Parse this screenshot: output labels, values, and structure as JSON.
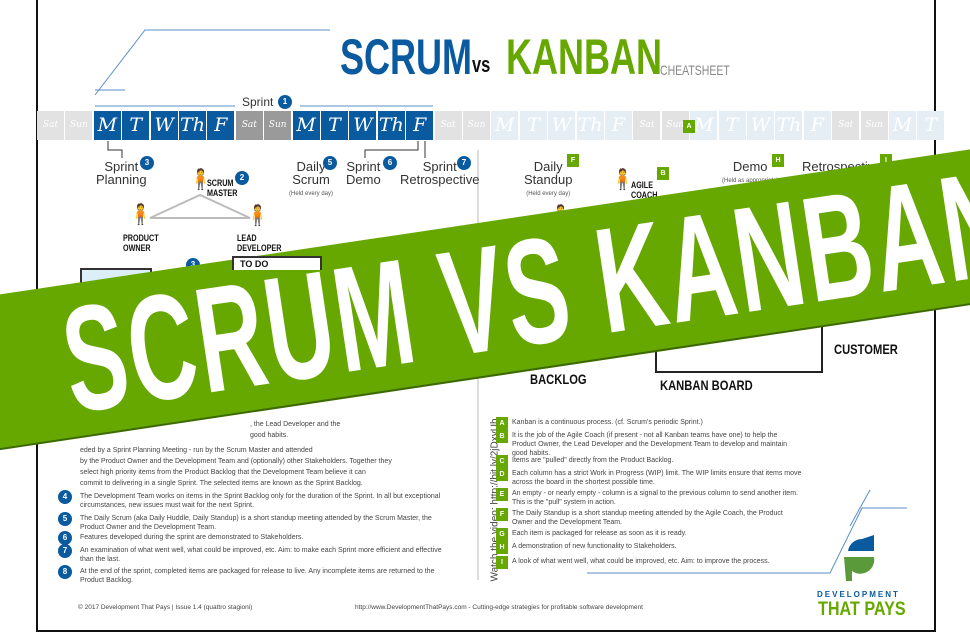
{
  "title": {
    "scrum": "SCRUM",
    "vs": "vs",
    "kanban": "KANBAN",
    "subtitle": "CHEATSHEET"
  },
  "colors": {
    "scrum_blue": "#0a5aa0",
    "kanban_green": "#66a800"
  },
  "sprint": {
    "label": "Sprint",
    "badge": "1"
  },
  "days": [
    {
      "d": "Sat",
      "s": "wklight"
    },
    {
      "d": "Sun",
      "s": "wklight"
    },
    {
      "d": "M",
      "s": "active"
    },
    {
      "d": "T",
      "s": "active"
    },
    {
      "d": "W",
      "s": "active"
    },
    {
      "d": "Th",
      "s": "active"
    },
    {
      "d": "F",
      "s": "active"
    },
    {
      "d": "Sat",
      "s": "wkdark"
    },
    {
      "d": "Sun",
      "s": "wkdark"
    },
    {
      "d": "M",
      "s": "active"
    },
    {
      "d": "T",
      "s": "active"
    },
    {
      "d": "W",
      "s": "active"
    },
    {
      "d": "Th",
      "s": "active"
    },
    {
      "d": "F",
      "s": "active"
    },
    {
      "d": "Sat",
      "s": "wklight"
    },
    {
      "d": "Sun",
      "s": "wklight"
    },
    {
      "d": "M",
      "s": "faded"
    },
    {
      "d": "T",
      "s": "faded"
    },
    {
      "d": "W",
      "s": "faded"
    },
    {
      "d": "Th",
      "s": "faded"
    },
    {
      "d": "F",
      "s": "faded"
    },
    {
      "d": "Sat",
      "s": "wklight"
    },
    {
      "d": "Sun",
      "s": "wklight"
    },
    {
      "d": "M",
      "s": "faded"
    },
    {
      "d": "T",
      "s": "faded"
    },
    {
      "d": "W",
      "s": "faded"
    },
    {
      "d": "Th",
      "s": "faded"
    },
    {
      "d": "F",
      "s": "faded"
    },
    {
      "d": "Sat",
      "s": "wklight"
    },
    {
      "d": "Sun",
      "s": "wklight"
    },
    {
      "d": "M",
      "s": "faded"
    },
    {
      "d": "T",
      "s": "faded"
    }
  ],
  "scrum": {
    "events": {
      "planning": {
        "l1": "Sprint",
        "l2": "Planning",
        "badge": "3"
      },
      "daily": {
        "l1": "Daily",
        "l2": "Scrum",
        "note": "(Held every day)",
        "badge": "5"
      },
      "demo": {
        "l1": "Sprint",
        "l2": "Demo",
        "badge": "6"
      },
      "retro": {
        "l1": "Sprint",
        "l2": "Retrospective",
        "badge": "7"
      }
    },
    "roles": {
      "master": {
        "l1": "SCRUM",
        "l2": "MASTER",
        "badge": "2"
      },
      "owner": {
        "l1": "PRODUCT",
        "l2": "OWNER"
      },
      "lead": {
        "l1": "LEAD",
        "l2": "DEVELOPER"
      }
    },
    "board_badge": "3",
    "board_label": "TO DO",
    "partial_lines": [
      ", the Lead Developer and the",
      "good habits.",
      "eded by a Sprint Planning Meeting - run by the Scrum Master and attended",
      "by the Product Owner and the Development Team and (optionally) other Stakeholders. Together they",
      "select high priority items from the Product Backlog that the Development Team believe it can",
      "commit to delivering in a single Sprint. The selected items are known as the Sprint Backlog."
    ],
    "items": [
      {
        "n": "4",
        "t": "The Development Team works on items in the Sprint Backlog only for the duration of the Sprint. In all but exceptional circumstances, new issues must wait for the next Sprint."
      },
      {
        "n": "5",
        "t": "The Daily Scrum (aka Daily Huddle, Daily Standup) is a short standup meeting attended by the Scrum Master, the Product Owner and the Development Team."
      },
      {
        "n": "6",
        "t": "Features developed during the sprint are demonstrated to Stakeholders."
      },
      {
        "n": "7",
        "t": "An examination of what went well, what could be improved, etc. Aim: to make each Sprint more efficient and effective than the last."
      },
      {
        "n": "8",
        "t": "At the end of the sprint, completed items are packaged for release to live. Any incomplete items are returned to the Product Backlog."
      }
    ]
  },
  "kanban": {
    "process_badge": "A",
    "events": {
      "standup": {
        "l1": "Daily",
        "l2": "Standup",
        "note": "(Held every day)",
        "badge": "F"
      },
      "demo": {
        "l1": "Demo",
        "note": "(Held as appropriate)",
        "badge": "H"
      },
      "retro": {
        "l1": "Retrospective",
        "badge": "I"
      }
    },
    "roles": {
      "coach": {
        "l1": "AGILE",
        "l2": "COACH",
        "badge": "B"
      }
    },
    "labels": {
      "backlog": "BACKLOG",
      "board": "KANBAN BOARD",
      "customer": "CUSTOMER"
    },
    "video": "Watch the video: http://bit.ly/2jDxyUh",
    "items": [
      {
        "n": "A",
        "t": "Kanban is a continuous process. (cf. Scrum's periodic Sprint.)"
      },
      {
        "n": "B",
        "t": "It is the job of the Agile Coach (if present - not all Kanban teams have one) to help the Product Owner, the Lead Developer and the Development Team to develop and maintain good habits."
      },
      {
        "n": "C",
        "t": "Items are \"pulled\" directly from the Product Backlog."
      },
      {
        "n": "D",
        "t": "Each column has a strict Work in Progress (WIP) limit. The WIP limits ensure that items move across the board in the shortest possible time."
      },
      {
        "n": "E",
        "t": "An empty - or nearly empty - column is a signal to the previous column to send another item. This is the \"pull\" system in action."
      },
      {
        "n": "F",
        "t": "The Daily Standup is a short standup meeting attended by the Agile Coach, the Product Owner and the Development Team."
      },
      {
        "n": "G",
        "t": "Each item is packaged for release as soon as it is ready."
      },
      {
        "n": "H",
        "t": "A demonstration of new functionality to Stakeholders."
      },
      {
        "n": "I",
        "t": "A look of what went well, what could be improved, etc. Aim: to improve the process."
      }
    ]
  },
  "footer": {
    "copyright": "© 2017 Development That Pays | Issue 1.4 (quattro stagioni)",
    "url": "http://www.DevelopmentThatPays.com - Cutting-edge strategies for profitable software development"
  },
  "logo": {
    "l1": "DEVELOPMENT",
    "l2": "THAT PAYS"
  },
  "banner": {
    "text": "SCRUM VS KANBAN"
  }
}
